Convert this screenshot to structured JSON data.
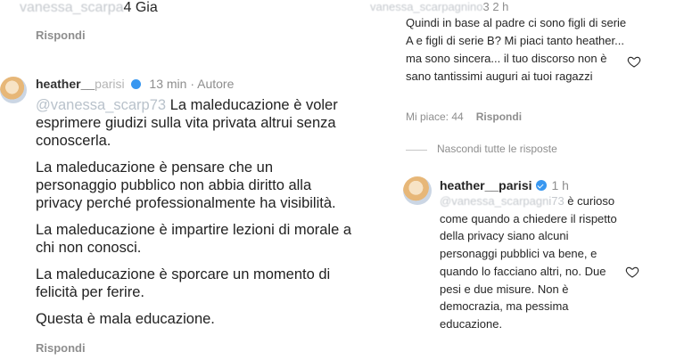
{
  "left": {
    "top_blurred": "vanessa_scarpa",
    "top_text": "4 Gia",
    "reply_label_1": "Rispondi",
    "comment": {
      "username": "heather__",
      "username_suffix": "parisi",
      "time": "13 min",
      "author_tag": "Autore",
      "mention_blurred": "@vanessa_scarp",
      "mention_suffix": "73",
      "paragraphs": [
        "La maleducazione è voler esprimere giudizi sulla vita privata altrui senza conoscerla.",
        "La maleducazione è pensare che un personaggio pubblico non abbia diritto alla privacy perché professionalmente ha visibilità.",
        "La maleducazione è impartire lezioni di morale a chi non conosci.",
        "La maleducazione è sporcare un momento di felicità per ferire.",
        "Questa è mala educazione."
      ]
    },
    "reply_label_2": "Rispondi"
  },
  "right": {
    "top_blurred": "vanessa_scarpagnino",
    "top_time_suffix": "3 2 h",
    "comment1": "Quindi in base al padre ci sono figli di serie A e figli di serie B? Mi piaci tanto heather... ma sono sincera... il tuo discorso non è sano tantissimi auguri ai tuoi ragazzi",
    "likes": "Mi piace: 44",
    "reply_label": "Rispondi",
    "hide_replies": "Nascondi tutte le risposte",
    "reply": {
      "username": "heather__parisi",
      "time": "1 h",
      "mention_blurred": "@vanessa_scarpagn",
      "mention_suffix": "i73",
      "text_start": " è curioso come quando a chiedere il rispetto della privacy siano alcuni personaggi pubblici va bene, e quando lo facciano altri, no. Due pesi e due misure. Non è democrazia, ma pessima educazione."
    }
  },
  "icons": {
    "heart": "heart-outline-icon",
    "verified": "verified-badge-icon",
    "avatar": "profile-avatar"
  },
  "colors": {
    "verified_blue": "#3897f0",
    "muted_gray": "#8e8e8e",
    "text": "#262626"
  }
}
